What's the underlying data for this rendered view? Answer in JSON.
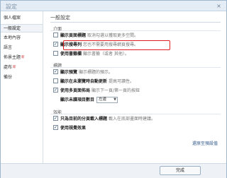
{
  "window": {
    "title": "設定",
    "close_symbol": "×"
  },
  "sidebar": {
    "items": [
      {
        "label": "個人檔案",
        "badge": ""
      },
      {
        "label": "一般設定",
        "badge": ""
      },
      {
        "label": "本地內容",
        "badge": ""
      },
      {
        "label": "語言",
        "badge": ""
      },
      {
        "label": "佈景主題",
        "badge": "新"
      },
      {
        "label": "處布",
        "badge": "新"
      },
      {
        "label": "備份",
        "badge": ""
      }
    ]
  },
  "main": {
    "section_title": "一般設定",
    "groups": [
      {
        "label": "介面",
        "options": [
          {
            "label": "顯示頁面標題",
            "desc": "取消勾選以獲取更多空間。",
            "checked": false
          },
          {
            "label": "顯示搜尋列",
            "desc": "您也不需要用搜尋網頁搜尋。",
            "checked": true
          },
          {
            "label": "使用書籤欄",
            "desc": "顯示書籤（或者 其他）。",
            "checked": false
          }
        ]
      },
      {
        "label": "標題",
        "options": [
          {
            "label": "顯示預覽",
            "desc": "顯示標題的預示。",
            "checked": true
          },
          {
            "label": "顯示在未瀏覽時自動更新",
            "desc": "提高可讀性。",
            "checked": false
          },
          {
            "label": "使用多頁面佈局",
            "desc": "顯示下一頁/第一頁的按鈕",
            "checked": true
          }
        ],
        "select": {
          "label": "顯示未讀項目數目",
          "value": "左邊"
        }
      },
      {
        "label": "效能",
        "options": [
          {
            "label": "只為目前的分頁載入標題",
            "desc": "載入在底部畫面時建議。",
            "checked": true
          },
          {
            "label": "使用視覺效果",
            "desc": "",
            "checked": true
          }
        ]
      }
    ],
    "reset_label": "還原至預設值"
  },
  "footer": {
    "done_label": "完成"
  },
  "colors": {
    "highlight": "#e02020",
    "title_text": "#7f93a8",
    "link": "#335a88"
  }
}
